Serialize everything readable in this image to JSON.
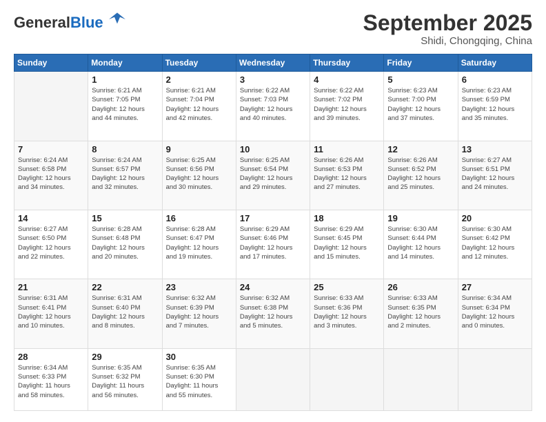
{
  "logo": {
    "general": "General",
    "blue": "Blue"
  },
  "header": {
    "month": "September 2025",
    "location": "Shidi, Chongqing, China"
  },
  "days_of_week": [
    "Sunday",
    "Monday",
    "Tuesday",
    "Wednesday",
    "Thursday",
    "Friday",
    "Saturday"
  ],
  "weeks": [
    [
      {
        "day": "",
        "info": ""
      },
      {
        "day": "1",
        "info": "Sunrise: 6:21 AM\nSunset: 7:05 PM\nDaylight: 12 hours\nand 44 minutes."
      },
      {
        "day": "2",
        "info": "Sunrise: 6:21 AM\nSunset: 7:04 PM\nDaylight: 12 hours\nand 42 minutes."
      },
      {
        "day": "3",
        "info": "Sunrise: 6:22 AM\nSunset: 7:03 PM\nDaylight: 12 hours\nand 40 minutes."
      },
      {
        "day": "4",
        "info": "Sunrise: 6:22 AM\nSunset: 7:02 PM\nDaylight: 12 hours\nand 39 minutes."
      },
      {
        "day": "5",
        "info": "Sunrise: 6:23 AM\nSunset: 7:00 PM\nDaylight: 12 hours\nand 37 minutes."
      },
      {
        "day": "6",
        "info": "Sunrise: 6:23 AM\nSunset: 6:59 PM\nDaylight: 12 hours\nand 35 minutes."
      }
    ],
    [
      {
        "day": "7",
        "info": "Sunrise: 6:24 AM\nSunset: 6:58 PM\nDaylight: 12 hours\nand 34 minutes."
      },
      {
        "day": "8",
        "info": "Sunrise: 6:24 AM\nSunset: 6:57 PM\nDaylight: 12 hours\nand 32 minutes."
      },
      {
        "day": "9",
        "info": "Sunrise: 6:25 AM\nSunset: 6:56 PM\nDaylight: 12 hours\nand 30 minutes."
      },
      {
        "day": "10",
        "info": "Sunrise: 6:25 AM\nSunset: 6:54 PM\nDaylight: 12 hours\nand 29 minutes."
      },
      {
        "day": "11",
        "info": "Sunrise: 6:26 AM\nSunset: 6:53 PM\nDaylight: 12 hours\nand 27 minutes."
      },
      {
        "day": "12",
        "info": "Sunrise: 6:26 AM\nSunset: 6:52 PM\nDaylight: 12 hours\nand 25 minutes."
      },
      {
        "day": "13",
        "info": "Sunrise: 6:27 AM\nSunset: 6:51 PM\nDaylight: 12 hours\nand 24 minutes."
      }
    ],
    [
      {
        "day": "14",
        "info": "Sunrise: 6:27 AM\nSunset: 6:50 PM\nDaylight: 12 hours\nand 22 minutes."
      },
      {
        "day": "15",
        "info": "Sunrise: 6:28 AM\nSunset: 6:48 PM\nDaylight: 12 hours\nand 20 minutes."
      },
      {
        "day": "16",
        "info": "Sunrise: 6:28 AM\nSunset: 6:47 PM\nDaylight: 12 hours\nand 19 minutes."
      },
      {
        "day": "17",
        "info": "Sunrise: 6:29 AM\nSunset: 6:46 PM\nDaylight: 12 hours\nand 17 minutes."
      },
      {
        "day": "18",
        "info": "Sunrise: 6:29 AM\nSunset: 6:45 PM\nDaylight: 12 hours\nand 15 minutes."
      },
      {
        "day": "19",
        "info": "Sunrise: 6:30 AM\nSunset: 6:44 PM\nDaylight: 12 hours\nand 14 minutes."
      },
      {
        "day": "20",
        "info": "Sunrise: 6:30 AM\nSunset: 6:42 PM\nDaylight: 12 hours\nand 12 minutes."
      }
    ],
    [
      {
        "day": "21",
        "info": "Sunrise: 6:31 AM\nSunset: 6:41 PM\nDaylight: 12 hours\nand 10 minutes."
      },
      {
        "day": "22",
        "info": "Sunrise: 6:31 AM\nSunset: 6:40 PM\nDaylight: 12 hours\nand 8 minutes."
      },
      {
        "day": "23",
        "info": "Sunrise: 6:32 AM\nSunset: 6:39 PM\nDaylight: 12 hours\nand 7 minutes."
      },
      {
        "day": "24",
        "info": "Sunrise: 6:32 AM\nSunset: 6:38 PM\nDaylight: 12 hours\nand 5 minutes."
      },
      {
        "day": "25",
        "info": "Sunrise: 6:33 AM\nSunset: 6:36 PM\nDaylight: 12 hours\nand 3 minutes."
      },
      {
        "day": "26",
        "info": "Sunrise: 6:33 AM\nSunset: 6:35 PM\nDaylight: 12 hours\nand 2 minutes."
      },
      {
        "day": "27",
        "info": "Sunrise: 6:34 AM\nSunset: 6:34 PM\nDaylight: 12 hours\nand 0 minutes."
      }
    ],
    [
      {
        "day": "28",
        "info": "Sunrise: 6:34 AM\nSunset: 6:33 PM\nDaylight: 11 hours\nand 58 minutes."
      },
      {
        "day": "29",
        "info": "Sunrise: 6:35 AM\nSunset: 6:32 PM\nDaylight: 11 hours\nand 56 minutes."
      },
      {
        "day": "30",
        "info": "Sunrise: 6:35 AM\nSunset: 6:30 PM\nDaylight: 11 hours\nand 55 minutes."
      },
      {
        "day": "",
        "info": ""
      },
      {
        "day": "",
        "info": ""
      },
      {
        "day": "",
        "info": ""
      },
      {
        "day": "",
        "info": ""
      }
    ]
  ]
}
